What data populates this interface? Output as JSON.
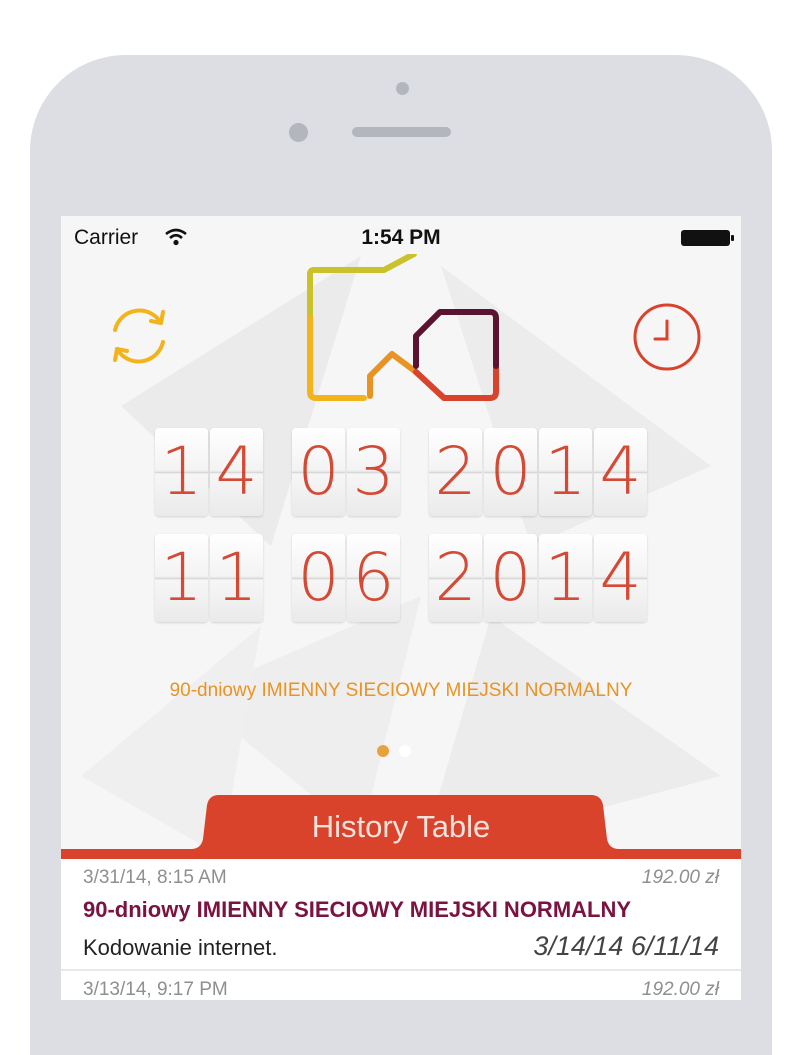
{
  "status_bar": {
    "carrier": "Carrier",
    "time": "1:54 PM"
  },
  "toolbar": {
    "refresh_icon": "refresh-icon",
    "history_icon": "clock-icon"
  },
  "dates": {
    "start": {
      "day": "14",
      "month": "03",
      "year": "2014"
    },
    "end": {
      "day": "11",
      "month": "06",
      "year": "2014"
    }
  },
  "ticket": {
    "name": "90-dniowy IMIENNY SIECIOWY MIEJSKI NORMALNY"
  },
  "pager": {
    "pages": 2,
    "current": 1
  },
  "history": {
    "title": "History Table",
    "entries": [
      {
        "datetime": "3/31/14, 8:15 AM",
        "price": "192.00 zł",
        "name": "90-dniowy IMIENNY SIECIOWY MIEJSKI NORMALNY",
        "source": "Kodowanie internet.",
        "range": "3/14/14  6/11/14"
      },
      {
        "datetime": "3/13/14, 9:17 PM",
        "price": "192.00 zł",
        "name": "",
        "source": "",
        "range": ""
      }
    ]
  },
  "colors": {
    "accent_red": "#d9432c",
    "accent_orange": "#e89425",
    "accent_yellow": "#f2b31b",
    "ticket_name_color": "#7a1342"
  }
}
